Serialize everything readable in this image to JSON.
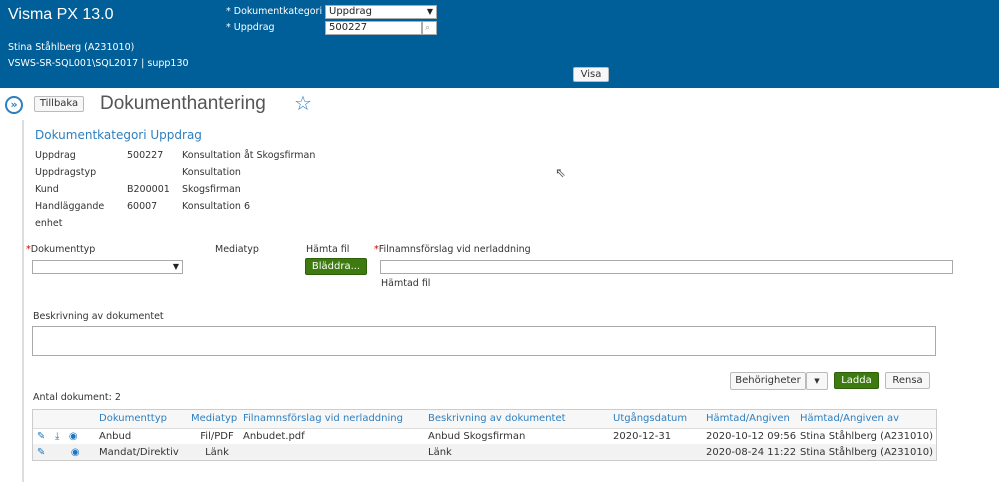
{
  "header": {
    "app_title": "Visma PX 13.0",
    "user": "Stina Ståhlberg (A231010)",
    "server": "VSWS-SR-SQL001\\SQL2017 | supp130",
    "dokumentkategori_label": "Dokumentkategori",
    "dokumentkategori_value": "Uppdrag",
    "uppdrag_label": "Uppdrag",
    "uppdrag_value": "500227",
    "visa_label": "Visa",
    "required_mark": "*"
  },
  "titlebar": {
    "back_label": "Tillbaka",
    "page_title": "Dokumenthantering"
  },
  "info": {
    "heading": "Dokumentkategori Uppdrag",
    "rows": [
      {
        "label": "Uppdrag",
        "code": "500227",
        "name": "Konsultation åt Skogsfirman"
      },
      {
        "label": "Uppdragstyp",
        "code": "",
        "name": "Konsultation"
      },
      {
        "label": "Kund",
        "code": "B200001",
        "name": "Skogsfirman"
      },
      {
        "label": "Handläggande enhet",
        "code": "60007",
        "name": "Konsultation 6"
      }
    ]
  },
  "form": {
    "dokumenttyp_label": "Dokumenttyp",
    "mediatyp_label": "Mediatyp",
    "hamta_fil_label": "Hämta fil",
    "browse_label": "Bläddra...",
    "filnamn_label": "Filnamnsförslag vid nerladdning",
    "hamtad_fil_label": "Hämtad fil",
    "beskrivning_label": "Beskrivning av dokumentet"
  },
  "actions": {
    "behorigheter": "Behörigheter",
    "ladda": "Ladda",
    "rensa": "Rensa"
  },
  "list": {
    "count_label": "Antal dokument: 2",
    "columns": [
      "Dokumenttyp",
      "Mediatyp",
      "Filnamnsförslag vid nerladdning",
      "Beskrivning av dokumentet",
      "Utgångsdatum",
      "Hämtad/Angiven",
      "Hämtad/Angiven av"
    ],
    "rows": [
      {
        "typ": "Anbud",
        "media": "Fil/PDF",
        "fil": "Anbudet.pdf",
        "beskr": "Anbud Skogsfirman",
        "utg": "2020-12-31",
        "hamtad": "2020-10-12 09:56",
        "av": "Stina Ståhlberg (A231010)"
      },
      {
        "typ": "Mandat/Direktiv",
        "media": "Länk",
        "fil": "",
        "beskr": "Länk",
        "utg": "",
        "hamtad": "2020-08-24 11:22",
        "av": "Stina Ståhlberg (A231010)"
      }
    ]
  },
  "colors": {
    "header": "#005f98",
    "accent": "#2e7fbf",
    "green": "#3d7a0f"
  }
}
